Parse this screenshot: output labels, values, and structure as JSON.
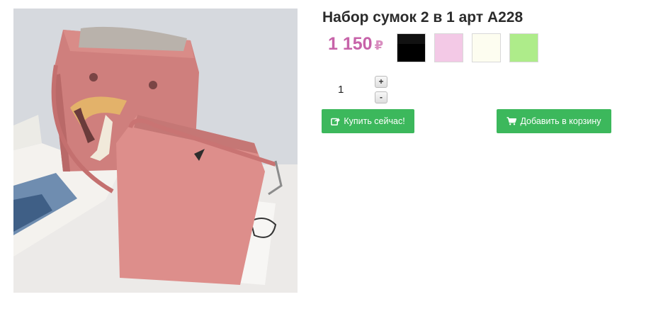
{
  "product": {
    "title": "Набор сумок 2 в 1 арт A228",
    "image_alt": "Pink two-piece handbag set with scarf and tassel"
  },
  "price": {
    "amount": "1 150",
    "currency": "₽"
  },
  "colors": [
    {
      "name": "black",
      "hex": "#000000"
    },
    {
      "name": "pink",
      "hex": "#f3c9e6"
    },
    {
      "name": "cream",
      "hex": "#fdfdf0"
    },
    {
      "name": "green",
      "hex": "#aeec8a"
    }
  ],
  "quantity": {
    "value": "1",
    "plus_label": "+",
    "minus_label": "-"
  },
  "actions": {
    "buy_now_label": "Купить сейчас!",
    "buy_now_icon": "share-square-icon",
    "add_to_cart_label": "Добавить в корзину",
    "add_to_cart_icon": "cart-icon",
    "button_color": "#3cb85c"
  },
  "accent": {
    "price_color": "#c763a9"
  }
}
